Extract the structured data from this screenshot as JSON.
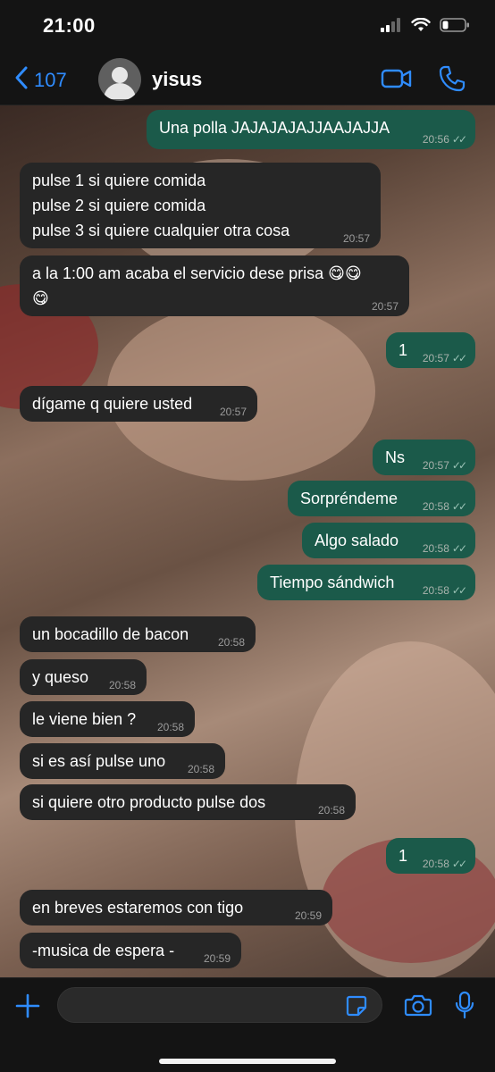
{
  "status_bar": {
    "time": "21:00"
  },
  "header": {
    "back_count": "107",
    "contact_name": "yisus"
  },
  "colors": {
    "accent": "#2f8cff",
    "outgoing_bubble": "#1b5a4a",
    "incoming_bubble": "#262626"
  },
  "messages": [
    {
      "dir": "out",
      "text": "Una polla JAJAJAJAJJAAJAJJA",
      "time": "20:56"
    },
    {
      "dir": "in",
      "text": "pulse 1 si quiere comida\npulse 2 si quiere comida\npulse 3 si quiere cualquier otra cosa",
      "time": "20:57"
    },
    {
      "dir": "in",
      "text": "a la 1:00 am acaba el servicio dese prisa 😋😋\n😋",
      "time": "20:57"
    },
    {
      "dir": "out",
      "text": "1",
      "time": "20:57"
    },
    {
      "dir": "in",
      "text": "dígame q quiere usted",
      "time": "20:57"
    },
    {
      "dir": "out",
      "text": "Ns",
      "time": "20:57"
    },
    {
      "dir": "out",
      "text": "Sorpréndeme",
      "time": "20:58"
    },
    {
      "dir": "out",
      "text": "Algo salado",
      "time": "20:58"
    },
    {
      "dir": "out",
      "text": "Tiempo sándwich",
      "time": "20:58"
    },
    {
      "dir": "in",
      "text": "un bocadillo de bacon",
      "time": "20:58"
    },
    {
      "dir": "in",
      "text": "y queso",
      "time": "20:58"
    },
    {
      "dir": "in",
      "text": "le viene bien ?",
      "time": "20:58"
    },
    {
      "dir": "in",
      "text": "si es así pulse uno",
      "time": "20:58"
    },
    {
      "dir": "in",
      "text": "si quiere otro producto pulse dos",
      "time": "20:58"
    },
    {
      "dir": "out",
      "text": "1",
      "time": "20:58"
    },
    {
      "dir": "in",
      "text": "en breves estaremos con tigo",
      "time": "20:59"
    },
    {
      "dir": "in",
      "text": "-musica de espera -",
      "time": "20:59"
    }
  ],
  "input": {
    "placeholder": ""
  }
}
